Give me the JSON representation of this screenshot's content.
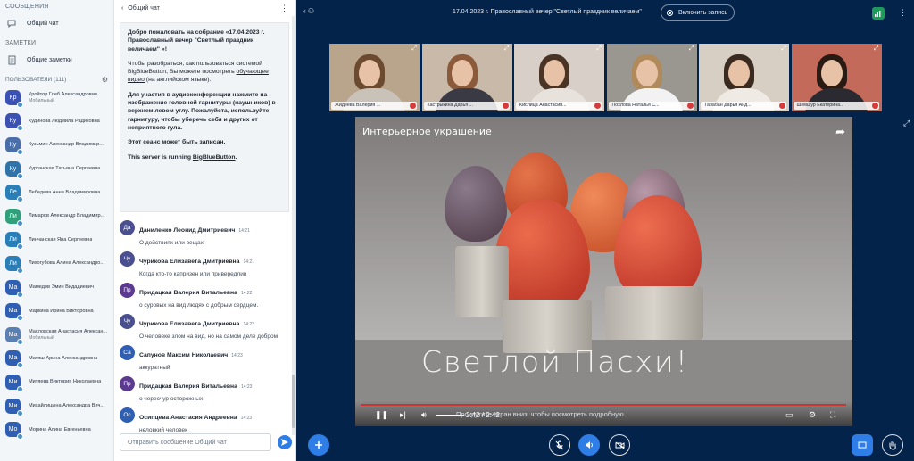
{
  "left": {
    "messages_h": "СООБЩЕНИЯ",
    "public_chat": "Общий чат",
    "notes_h": "ЗАМЕТКИ",
    "shared_notes": "Общие заметки",
    "users_h": "ПОЛЬЗОВАТЕЛИ (111)",
    "users": [
      {
        "ini": "Кр",
        "name": "Кройтор Глеб Александрович",
        "sub": "Мобильный",
        "color": "#3b52b3"
      },
      {
        "ini": "Ку",
        "name": "Кудинова Людмила Радиковна",
        "sub": "",
        "color": "#3b52b3"
      },
      {
        "ini": "Ку",
        "name": "Кузьмин Александр Владимир...",
        "sub": "",
        "color": "#4a6fa8"
      },
      {
        "ini": "Ку",
        "name": "Курганская Татьяна Сергеевна",
        "sub": "",
        "color": "#2f73a8"
      },
      {
        "ini": "Ле",
        "name": "Лебедева Анна Владимировна",
        "sub": "",
        "color": "#2a7fb8"
      },
      {
        "ini": "Ли",
        "name": "Лимаров Александр Владимир...",
        "sub": "",
        "color": "#2fa07a"
      },
      {
        "ini": "Ли",
        "name": "Линчанская Яна Сергеевна",
        "sub": "",
        "color": "#2a7fb8"
      },
      {
        "ini": "Ли",
        "name": "Лихогубова Алина Александро...",
        "sub": "",
        "color": "#2a7fb8"
      },
      {
        "ini": "Ма",
        "name": "Мамедов Эмин Видадиевич",
        "sub": "",
        "color": "#2f5fb3"
      },
      {
        "ini": "Ма",
        "name": "Маркина Ирина Викторовна",
        "sub": "",
        "color": "#2f5fb3"
      },
      {
        "ini": "Ма",
        "name": "Масловская Анастасия Алексан...",
        "sub": "Мобильный",
        "color": "#5a7fb3"
      },
      {
        "ini": "Ма",
        "name": "Матяш Арина Александровна",
        "sub": "",
        "color": "#2f5fb3"
      },
      {
        "ini": "Ми",
        "name": "Митяева Виктория Николаевна",
        "sub": "",
        "color": "#2f5fb3"
      },
      {
        "ini": "Ми",
        "name": "Михайлицына Александра Вяч...",
        "sub": "",
        "color": "#2f5fb3"
      },
      {
        "ini": "Мо",
        "name": "Морина Алина Евгеньевна",
        "sub": "",
        "color": "#2f5fb3"
      }
    ]
  },
  "chat": {
    "title": "Общий чат",
    "welcome": {
      "p1": "Добро пожаловать на собрание «17.04.2023 г. Православный вечер \"Светлый праздник величаем\" »!",
      "p2a": "Чтобы разобраться, как пользоваться системой BigBlueButton, Вы можете посмотреть ",
      "p2link": "обучающее видео",
      "p2b": " (на английском языке).",
      "p3": "Для участия в аудиоконференции нажмите на изображение головной гарнитуры (наушников) в верхнем левом углу. Пожалуйста, используйте гарнитуру, чтобы уберечь себя и других от неприятного гула.",
      "p4": "Этот сеанс может быть записан.",
      "p5a": "This server is running ",
      "p5link": "BigBlueButton",
      "p5b": "."
    },
    "messages": [
      {
        "ini": "Да",
        "name": "Даниленко Леонид Дмитриевич",
        "time": "14:21",
        "text": "О действиях или вещах",
        "color": "#4a4f8f"
      },
      {
        "ini": "Чу",
        "name": "Чурикова Елизавета Дмитриевна",
        "time": "14:21",
        "text": "Когда кто-то капризен или привередлив",
        "color": "#4a4f8f"
      },
      {
        "ini": "Пр",
        "name": "Придацкая Валерия Витальевна",
        "time": "14:22",
        "text": "о суровых на вид людях с добрым сердцем.",
        "color": "#5b3a8f"
      },
      {
        "ini": "Чу",
        "name": "Чурикова Елизавета Дмитриевна",
        "time": "14:22",
        "text": "О человеке злом на вид, но на самом деле добром",
        "color": "#4a4f8f"
      },
      {
        "ini": "Са",
        "name": "Сапунов Максим Николаевич",
        "time": "14:23",
        "text": "аккуратный",
        "color": "#2f5fb3"
      },
      {
        "ini": "Пр",
        "name": "Придацкая Валерия Витальевна",
        "time": "14:23",
        "text": "о чересчур осторожных",
        "color": "#5b3a8f"
      },
      {
        "ini": "Ос",
        "name": "Осипцева Анастасия Андреевна",
        "time": "14:23",
        "text": "неловкий человек",
        "color": "#2f5fb3"
      }
    ],
    "input_placeholder": "Отправить сообщение Общий чат"
  },
  "main": {
    "title": "17.04.2023 г. Православный вечер \"Светлый праздник величаем\"",
    "record": "Включить запись",
    "cams": [
      {
        "name": "Жидеева Валерия ...",
        "bg": "#b9a48c",
        "hair": "#6b4a30",
        "body": "#c9c2b9"
      },
      {
        "name": "Кастрыкина Дарья ...",
        "bg": "#c9b9a8",
        "hair": "#8a5a3a",
        "body": "#3a3a44"
      },
      {
        "name": "Кислица Анастасия...",
        "bg": "#d8d0c8",
        "hair": "#4a3426",
        "body": "#e8e2dc"
      },
      {
        "name": "Похлова Наталья С...",
        "bg": "#9a9690",
        "hair": "#b08a5a",
        "body": "#f2f2f2"
      },
      {
        "name": "Тарабан Дарья Анд...",
        "bg": "#d8cfc4",
        "hair": "#3a2a20",
        "body": "#efeae4"
      },
      {
        "name": "Шемшур Екатерина...",
        "bg": "#c46a5a",
        "hair": "#2a1a14",
        "body": "#2a2a30"
      }
    ],
    "video": {
      "title": "Интерьерное украшение",
      "caption": "Светлой Пасхи!",
      "time": "2:42 / 2:42",
      "hint": "Прокрутите экран вниз, чтобы посмотреть подробную",
      "progress": 1.0
    }
  }
}
